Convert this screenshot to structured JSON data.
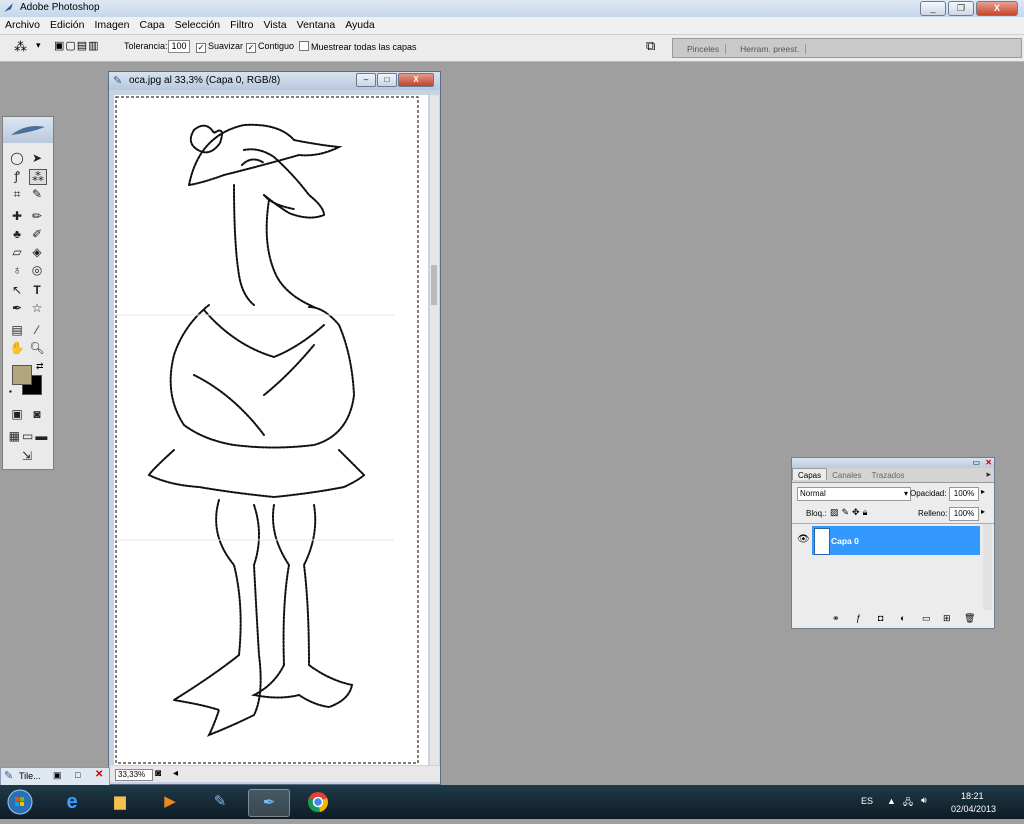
{
  "app": {
    "title": "Adobe Photoshop",
    "window_controls": [
      "_",
      "❐",
      "X"
    ]
  },
  "menu": [
    "Archivo",
    "Edición",
    "Imagen",
    "Capa",
    "Selección",
    "Filtro",
    "Vista",
    "Ventana",
    "Ayuda"
  ],
  "options_bar": {
    "tolerance_label": "Tolerancia:",
    "tolerance_value": "100",
    "smooth_label": "Suavizar",
    "contiguous_label": "Contiguo",
    "sample_all_label": "Muestrear todas las capas",
    "panel_tabs": [
      "Pinceles",
      "Herram. preest."
    ]
  },
  "document": {
    "title": "oca.jpg al 33,3% (Capa 0, RGB/8)",
    "zoom": "33,33%",
    "window_controls": [
      "–",
      "□",
      "X"
    ]
  },
  "layers_panel": {
    "tabs": [
      "Capas",
      "Canales",
      "Trazados"
    ],
    "blend_mode": "Normal",
    "opacity_label": "Opacidad:",
    "opacity_value": "100%",
    "lock_label": "Bloq.:",
    "fill_label": "Relleno:",
    "fill_value": "100%",
    "layers": [
      {
        "name": "Capa 0",
        "visible": true,
        "selected": true
      }
    ]
  },
  "colors": {
    "foreground": "#b3a57c",
    "background": "#000000",
    "selected_layer": "#3399ff"
  },
  "minimized": {
    "label": "Tile..."
  },
  "taskbar": {
    "apps": [
      "start-orb-icon",
      "internet-explorer-icon",
      "file-explorer-icon",
      "media-player-icon",
      "app-icon",
      "photoshop-icon",
      "chrome-icon"
    ],
    "language": "ES",
    "time": "18:21",
    "date": "02/04/2013"
  }
}
